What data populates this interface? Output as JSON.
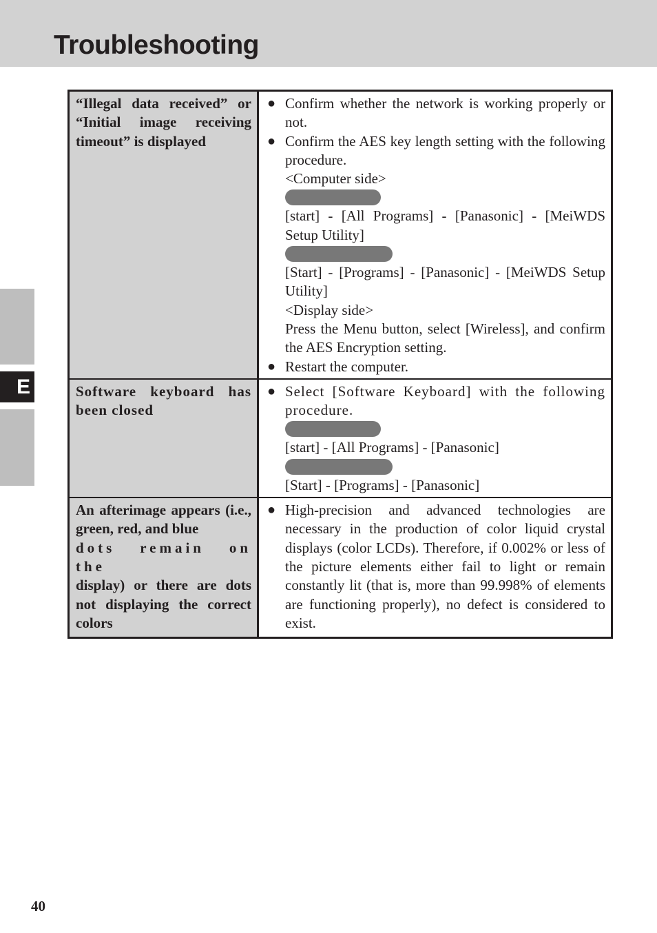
{
  "header": {
    "title": "Troubleshooting"
  },
  "side_tabs": {
    "active_label": "E"
  },
  "table": {
    "rows": [
      {
        "problem": "“Illegal data received” or “Initial image receiving timeout” is displayed",
        "items": [
          {
            "text": "Confirm whether the network is working properly or not."
          },
          {
            "text": "Confirm the AES key length setting with the following procedure.",
            "computer_side": "<Computer side>",
            "path1": "[start] - [All Programs] - [Panasonic] - [MeiWDS Setup Utility]",
            "path2": "[Start] - [Programs] - [Panasonic] - [MeiWDS Setup Utility]",
            "display_side": "<Display side>",
            "display_instruction": "Press the Menu button, select [Wireless], and confirm the AES Encryption setting."
          },
          {
            "text": "Restart the computer."
          }
        ]
      },
      {
        "problem": "Software keyboard has been closed",
        "items": [
          {
            "text": "Select [Software Keyboard] with the following procedure.",
            "path1": "[start] - [All Programs] - [Panasonic]",
            "path2": "[Start] - [Programs] - [Panasonic]"
          }
        ]
      },
      {
        "problem_line1": "An afterimage appears (i.e., green, red, and blue",
        "problem_line2": "dots remain on the",
        "problem_line3": "display) or there are dots not displaying the correct colors",
        "items": [
          {
            "text": "High-precision and advanced technologies are necessary in the production of color liquid crystal displays (color LCDs). Therefore, if 0.002% or less of the picture elements either fail to light or remain constantly lit (that is, more than 99.998% of elements are functioning properly), no defect is considered to exist."
          }
        ]
      }
    ],
    "bullet_glyph": "●"
  },
  "footer": {
    "page_number": "40"
  }
}
